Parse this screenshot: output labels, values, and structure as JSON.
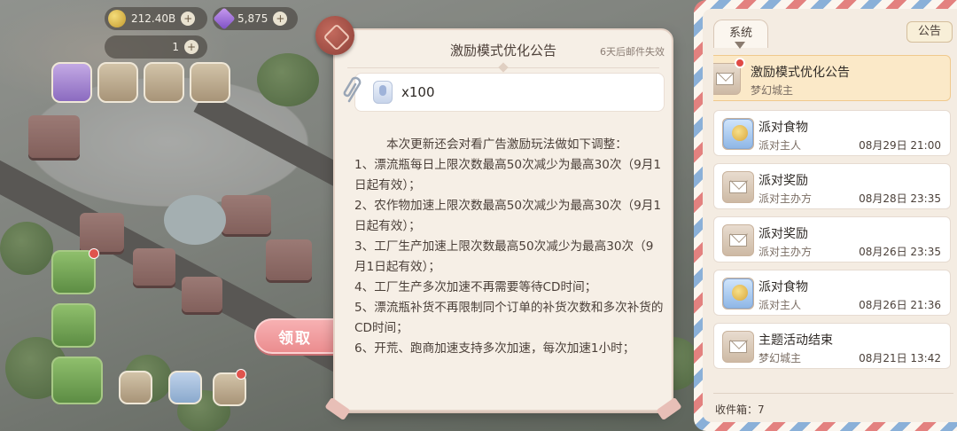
{
  "hud": {
    "coins": "212.40B",
    "gems": "5,875",
    "energy": "1"
  },
  "notice": {
    "title": "激励模式优化公告",
    "expire": "6天后邮件失效",
    "attachment_qty": "x100",
    "body": [
      "本次更新还会对看广告激励玩法做如下调整：",
      "1、漂流瓶每日上限次数最高50次减少为最高30次（9月1日起有效）；",
      "2、农作物加速上限次数最高50次减少为最高30次（9月1日起有效）；",
      "3、工厂生产加速上限次数最高50次减少为最高30次（9月1日起有效）；",
      "4、工厂生产多次加速不再需要等待CD时间；",
      "5、漂流瓶补货不再限制同个订单的补货次数和多次补货的CD时间；",
      "6、开荒、跑商加速支持多次加速，每次加速1小时；"
    ],
    "claim_label": "领取"
  },
  "mailbox": {
    "tab_system": "系统",
    "tab_notice": "公告",
    "inbox_label": "收件箱：7",
    "items": [
      {
        "title": "激励模式优化公告",
        "sender": "梦幻城主",
        "date": "",
        "icon": "envelope-icon",
        "active": true
      },
      {
        "title": "派对食物",
        "sender": "派对主人",
        "date": "08月29日 21:00",
        "icon": "party-food-icon"
      },
      {
        "title": "派对奖励",
        "sender": "派对主办方",
        "date": "08月28日 23:35",
        "icon": "envelope-icon"
      },
      {
        "title": "派对奖励",
        "sender": "派对主办方",
        "date": "08月26日 23:35",
        "icon": "envelope-icon"
      },
      {
        "title": "派对食物",
        "sender": "派对主人",
        "date": "08月26日 21:36",
        "icon": "party-food-icon"
      },
      {
        "title": "主题活动结束",
        "sender": "梦幻城主",
        "date": "08月21日 13:42",
        "icon": "envelope-icon"
      }
    ]
  },
  "colors": {
    "claim": "#eb8d8f",
    "active_item": "#fbe9c8",
    "unread": "#e04a45"
  }
}
